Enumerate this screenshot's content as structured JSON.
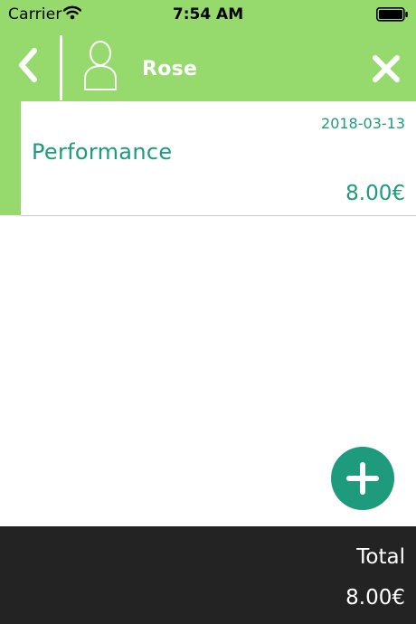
{
  "status_bar": {
    "carrier": "Carrier",
    "time": "7:54 AM",
    "icons": [
      "wifi-icon",
      "battery-icon"
    ]
  },
  "header": {
    "contact_name": "Rose",
    "icons": [
      "chevron-left-icon",
      "person-icon",
      "close-icon"
    ]
  },
  "entries": [
    {
      "date": "2018-03-13",
      "title": "Performance",
      "amount": "8.00€"
    }
  ],
  "fab": {
    "icon": "plus-icon"
  },
  "footer": {
    "total_label": "Total",
    "total_amount": "8.00€"
  },
  "colors": {
    "header_green": "#96da6e",
    "accent_teal": "#1e9a7d",
    "footer_dark": "#232323",
    "white": "#ffffff"
  }
}
